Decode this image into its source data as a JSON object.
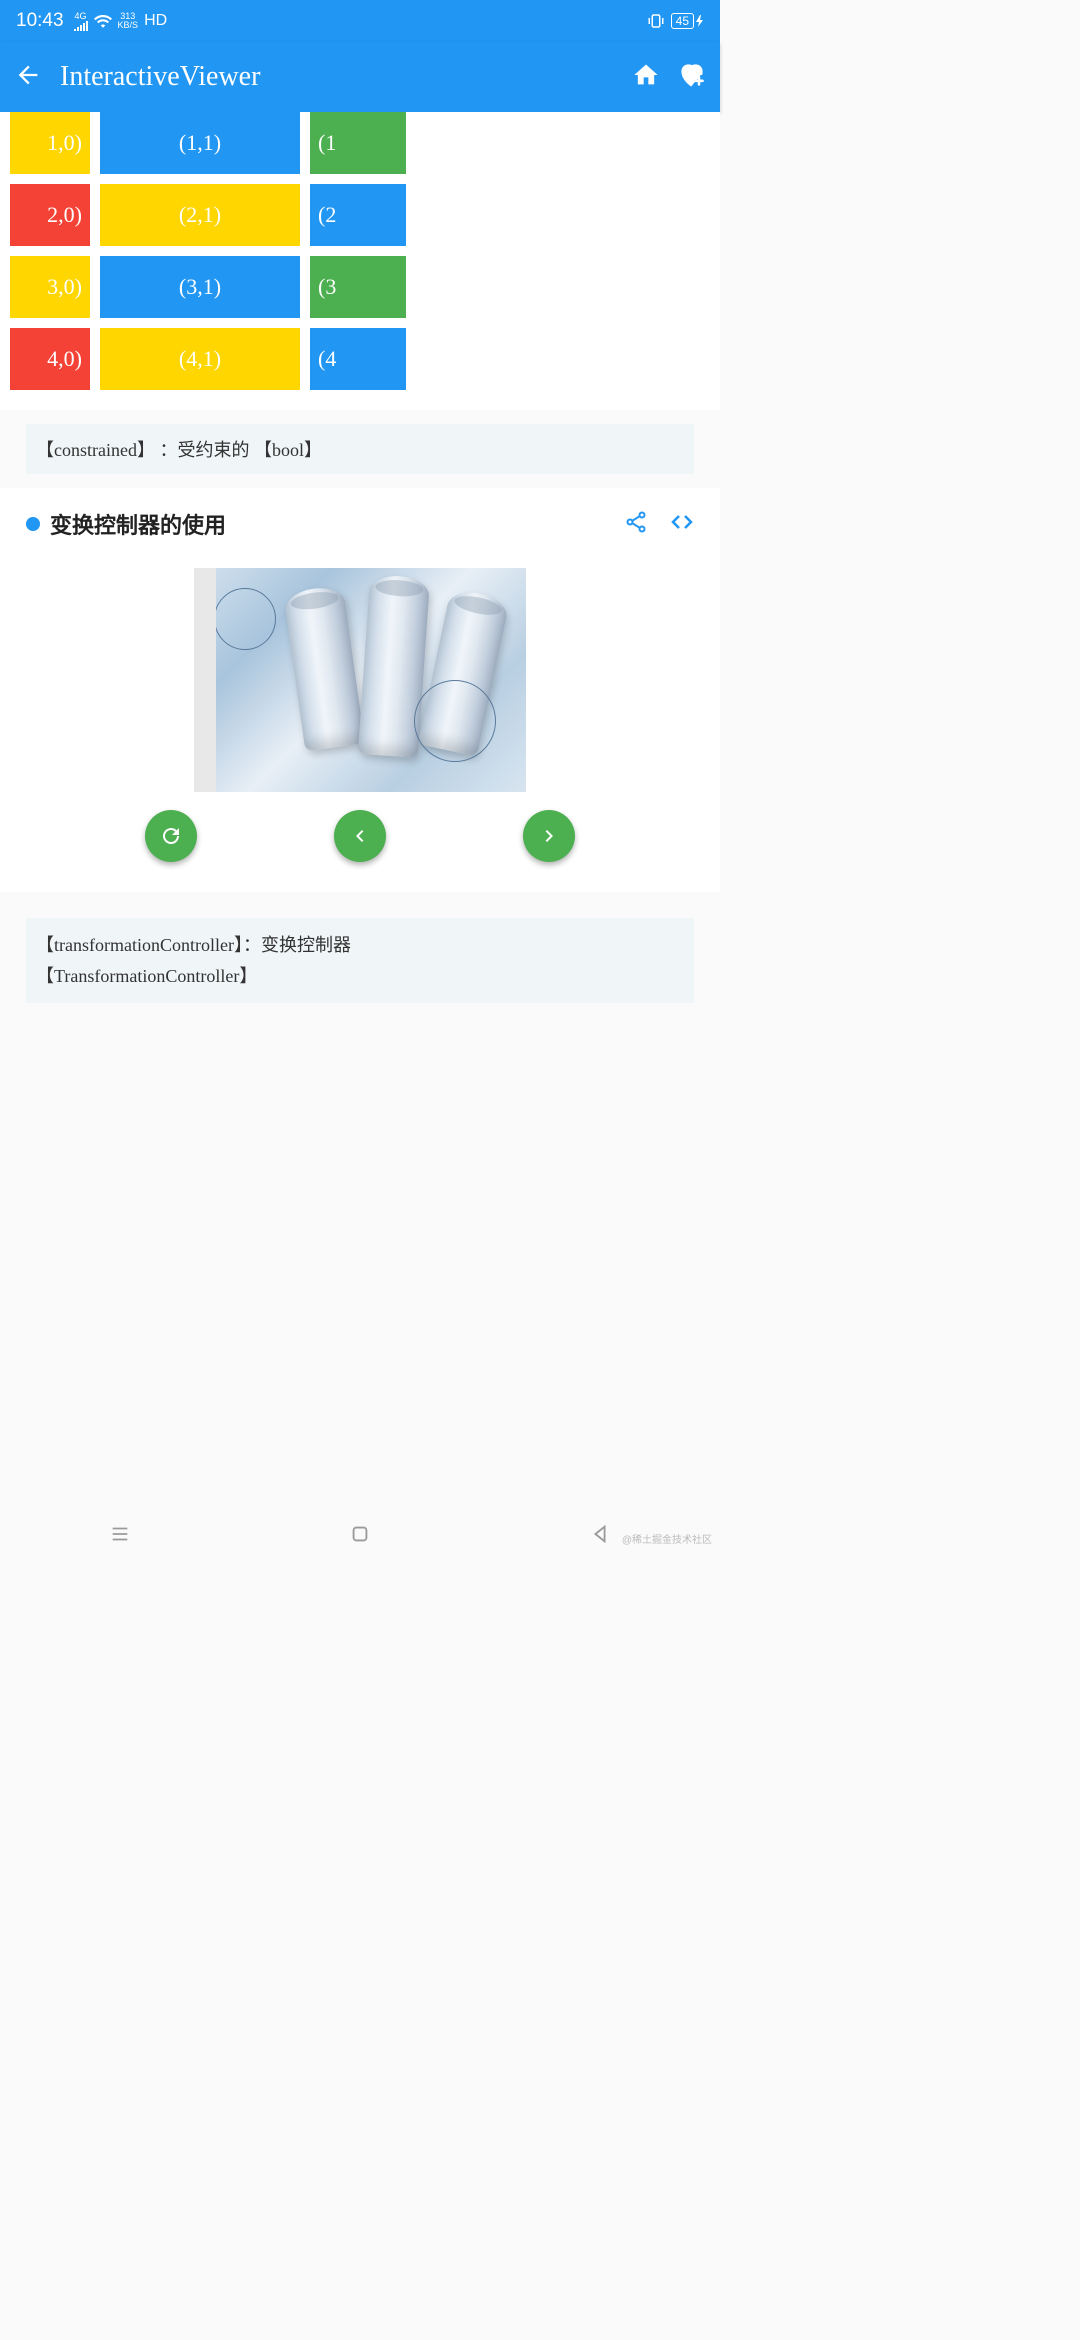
{
  "status": {
    "time": "10:43",
    "net_label": "4G",
    "speed_top": "313",
    "speed_bottom": "KB/S",
    "hd": "HD",
    "battery": "45"
  },
  "appbar": {
    "title": "InteractiveViewer"
  },
  "grid": {
    "rows": [
      {
        "cells": [
          {
            "txt": "1,0)",
            "cls": "yellow"
          },
          {
            "txt": "(1,1)",
            "cls": "blue"
          },
          {
            "txt": "(1",
            "cls": "green"
          }
        ]
      },
      {
        "cells": [
          {
            "txt": "2,0)",
            "cls": "red"
          },
          {
            "txt": "(2,1)",
            "cls": "yellow"
          },
          {
            "txt": "(2",
            "cls": "blue"
          }
        ]
      },
      {
        "cells": [
          {
            "txt": "3,0)",
            "cls": "yellow"
          },
          {
            "txt": "(3,1)",
            "cls": "blue"
          },
          {
            "txt": "(3",
            "cls": "green"
          }
        ]
      },
      {
        "cells": [
          {
            "txt": "4,0)",
            "cls": "red"
          },
          {
            "txt": "(4,1)",
            "cls": "yellow"
          },
          {
            "txt": "(4",
            "cls": "blue"
          }
        ]
      }
    ]
  },
  "prop1": "【constrained】 ：受约束的   【bool】",
  "section": {
    "title": "变换控制器的使用"
  },
  "prop2_line1": "【transformationController】：变换控制器",
  "prop2_line2": "【TransformationController】",
  "watermark": "@稀土掘金技术社区"
}
